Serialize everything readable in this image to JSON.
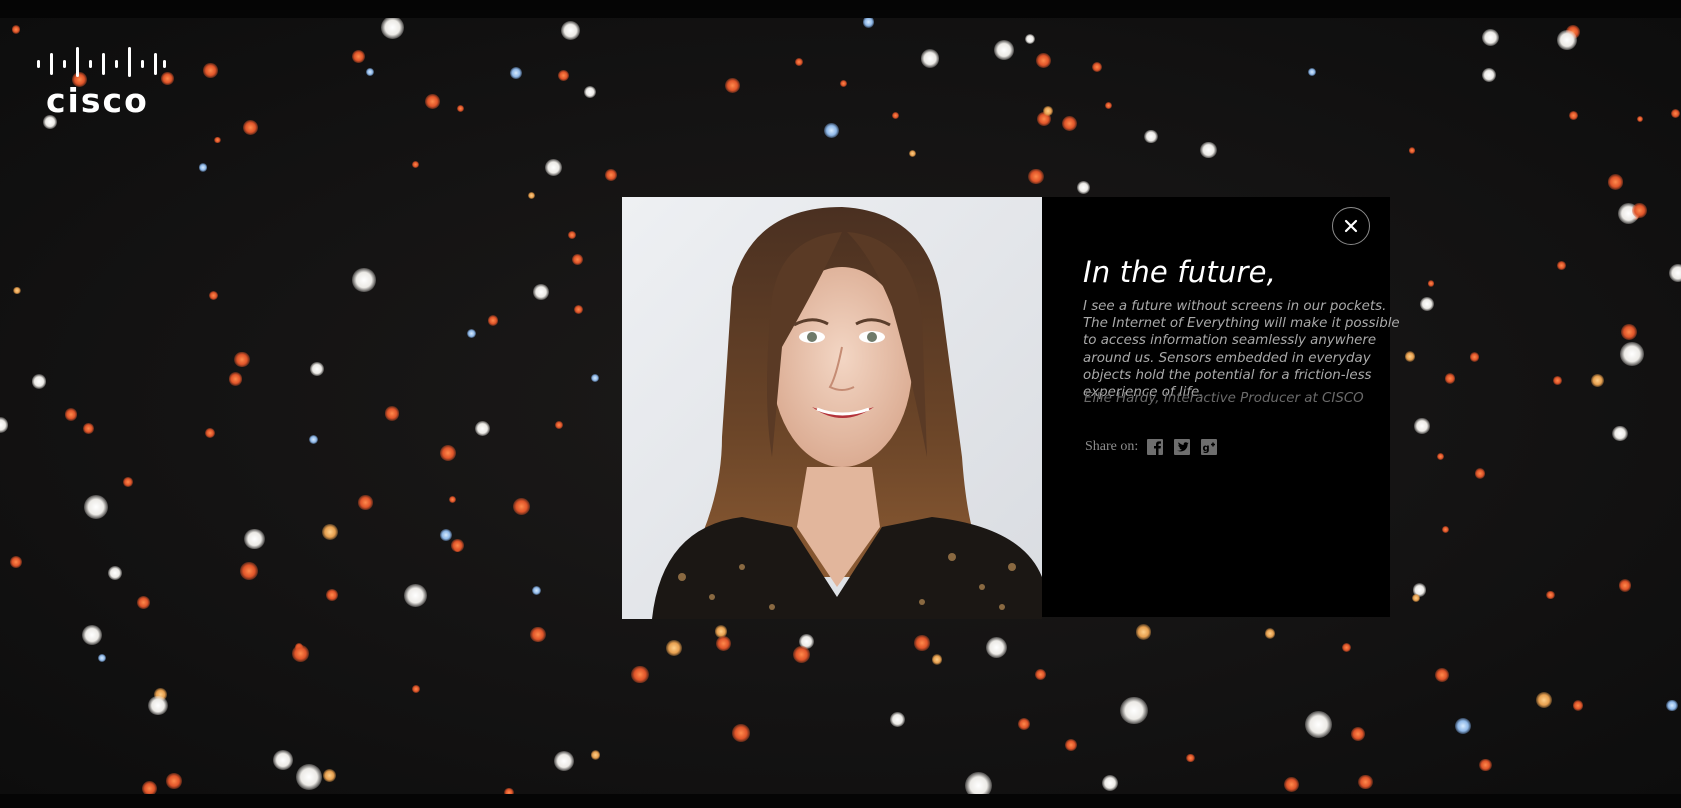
{
  "brand": {
    "name": "cisco",
    "logo_icon": "cisco-logo"
  },
  "modal": {
    "headline": "In the future,",
    "quote": "I see a future without screens in our pockets. The Internet of Everything will make it possible to access information seamlessly anywhere around us. Sensors embedded in everyday objects hold the potential for a friction-less experience of life.",
    "attribution": "Ellie Hardy, Interactive Producer at CISCO",
    "share_label": "Share on:",
    "share_icons": [
      "facebook-icon",
      "twitter-icon",
      "google-plus-icon"
    ],
    "close_icon": "close-icon",
    "photo_subject": "portrait photo"
  },
  "colors": {
    "background": "#0c0c0c",
    "panel": "#000000",
    "headline": "#ffffff",
    "body_text": "#a9a9a9",
    "bokeh_warm": "#e0552a",
    "bokeh_light": "#eceae6"
  }
}
